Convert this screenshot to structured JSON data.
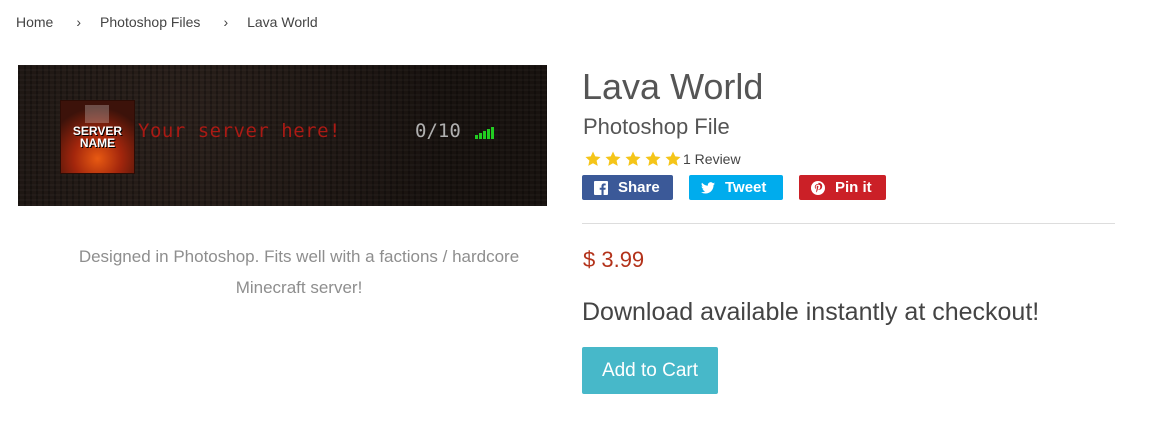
{
  "breadcrumb": {
    "items": [
      {
        "label": "Home"
      },
      {
        "label": "Photoshop Files"
      },
      {
        "label": "Lava World"
      }
    ],
    "separator": "›"
  },
  "banner": {
    "server_name": "SERVER NAME",
    "motd": "Your server here!",
    "players": "0/10",
    "signal_icon": "signal-bars-icon"
  },
  "description": "Designed in Photoshop. Fits well with a factions / hardcore Minecraft server!",
  "product": {
    "title": "Lava World",
    "subtitle": "Photoshop File",
    "rating": 5,
    "review_text": "1 Review",
    "price": "$ 3.99",
    "download_note": "Download available instantly at checkout!",
    "add_to_cart": "Add to Cart"
  },
  "social": {
    "share": "Share",
    "tweet": "Tweet",
    "pin": "Pin it"
  },
  "colors": {
    "facebook": "#3b5998",
    "twitter": "#00aced",
    "pinterest": "#cb2027",
    "price": "#b3321a",
    "button": "#47b8c9",
    "star": "#f5c518"
  }
}
